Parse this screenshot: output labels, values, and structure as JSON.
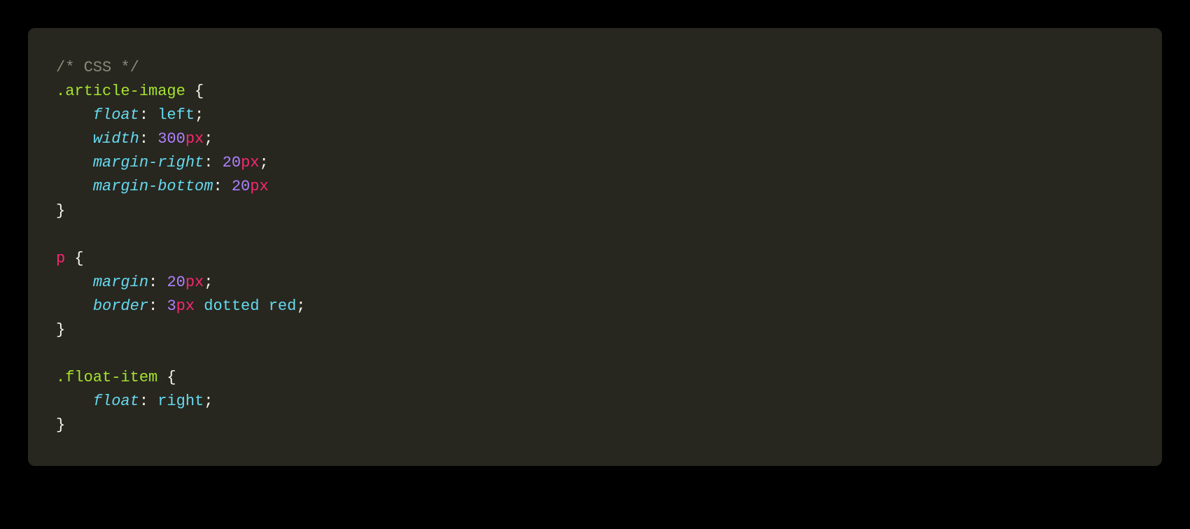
{
  "code": {
    "comment": "/* CSS */",
    "rules": [
      {
        "selector": ".article-image",
        "selector_type": "class",
        "declarations": [
          {
            "property": "float",
            "value_type": "keyword",
            "value": "left",
            "semicolon": true
          },
          {
            "property": "width",
            "value_type": "dimension",
            "number": "300",
            "unit": "px",
            "semicolon": true
          },
          {
            "property": "margin-right",
            "value_type": "dimension",
            "number": "20",
            "unit": "px",
            "semicolon": true
          },
          {
            "property": "margin-bottom",
            "value_type": "dimension",
            "number": "20",
            "unit": "px",
            "semicolon": false
          }
        ]
      },
      {
        "selector": "p",
        "selector_type": "tag",
        "declarations": [
          {
            "property": "margin",
            "value_type": "dimension",
            "number": "20",
            "unit": "px",
            "semicolon": true
          },
          {
            "property": "border",
            "value_type": "composite",
            "number": "3",
            "unit": "px",
            "tail": " dotted red",
            "semicolon": true
          }
        ]
      },
      {
        "selector": ".float-item",
        "selector_type": "class",
        "declarations": [
          {
            "property": "float",
            "value_type": "keyword",
            "value": "right",
            "semicolon": true
          }
        ]
      }
    ]
  },
  "indent": "    ",
  "braces": {
    "open": " {",
    "close": "}"
  }
}
